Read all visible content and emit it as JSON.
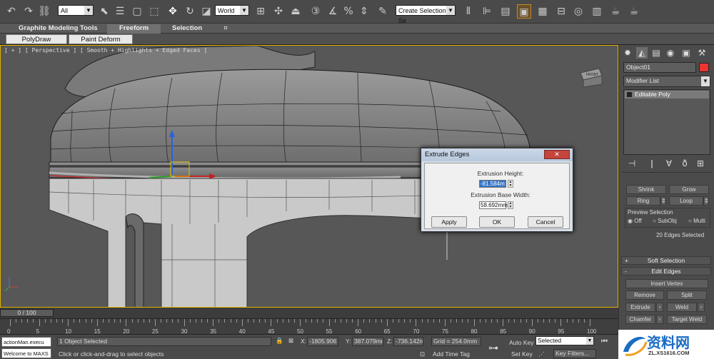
{
  "toolbar": {
    "selection_filter": "All",
    "reference_coord": "World",
    "named_selection_placeholder": "Create Selection Se"
  },
  "ribbon": {
    "tabs": [
      "Graphite Modeling Tools",
      "Freeform",
      "Selection"
    ],
    "subtabs": [
      "PolyDraw",
      "Paint Deform"
    ]
  },
  "viewport": {
    "label": "[ + ] [ Perspective ] [ Smooth + Highlights + Edged Faces ]",
    "viewcube_label": "FRONT"
  },
  "command_panel": {
    "object_name": "Object01",
    "modifier_list": "Modifier List",
    "stack_item": "Editable Poly",
    "selection": {
      "shrink": "Shrink",
      "grow": "Grow",
      "ring": "Ring",
      "loop": "Loop",
      "preview_label": "Preview Selection",
      "preview_off": "Off",
      "preview_subobj": "SubObj",
      "preview_multi": "Multi",
      "count": "20 Edges Selected"
    },
    "soft_selection": "Soft Selection",
    "edit_edges": "Edit Edges",
    "insert_vertex": "Insert Vertex",
    "remove": "Remove",
    "split": "Split",
    "extrude": "Extrude",
    "weld": "Weld",
    "chamfer": "Chamfer",
    "target_weld": "Target Weld"
  },
  "dialog": {
    "title": "Extrude Edges",
    "height_label": "Extrusion Height:",
    "height_value": "-81.584m",
    "width_label": "Extrusion Base Width:",
    "width_value": "58.692mm",
    "apply": "Apply",
    "ok": "OK",
    "cancel": "Cancel"
  },
  "timeline": {
    "frame": "0 / 100",
    "ticks": [
      "0",
      "5",
      "10",
      "15",
      "20",
      "25",
      "30",
      "35",
      "40",
      "45",
      "50",
      "55",
      "60",
      "65",
      "70",
      "75",
      "80",
      "85",
      "90",
      "95",
      "100"
    ]
  },
  "status": {
    "script_line1": "actionMan.execu",
    "script_line2": "Welcome to MAXS",
    "selected": "1 Object Selected",
    "prompt": "Click or click-and-drag to select objects",
    "x_label": "X:",
    "x": "-1805.906",
    "y_label": "Y:",
    "y": "387.079mm",
    "z_label": "Z:",
    "z": "-736.142m",
    "grid": "Grid = 254.0mm",
    "add_time_tag": "Add Time Tag",
    "auto_key": "Auto Key",
    "set_key": "Set Key",
    "key_mode": "Selected",
    "key_filters": "Key Filters..."
  },
  "watermark": {
    "text": "资料网",
    "url": "ZL.XS1616.COM"
  }
}
